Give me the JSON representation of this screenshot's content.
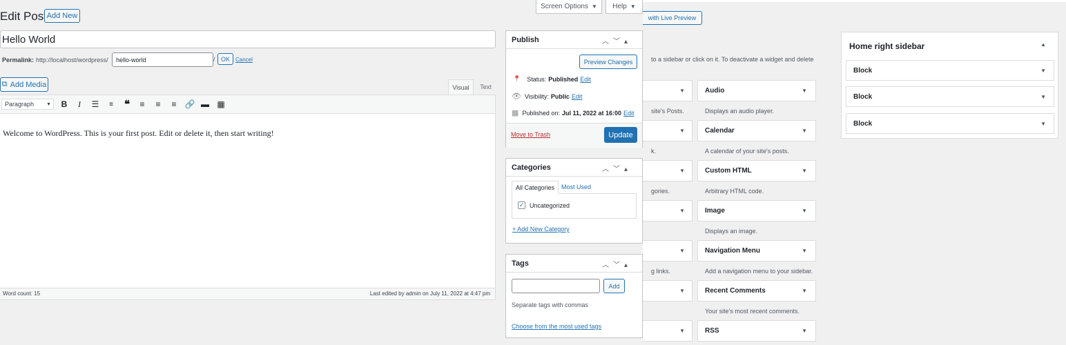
{
  "header": {
    "page_title": "Edit Post",
    "add_new_label": "Add New",
    "screen_options_label": "Screen Options",
    "help_label": "Help"
  },
  "post": {
    "title": "Hello World",
    "permalink_label": "Permalink:",
    "permalink_base": "http://localhost/wordpress/",
    "slug": "hello-world",
    "slug_suffix": "/",
    "ok_label": "OK",
    "cancel_label": "Cancel"
  },
  "editor": {
    "add_media_label": "Add Media",
    "tab_visual": "Visual",
    "tab_text": "Text",
    "format_select": "Paragraph",
    "content": "Welcome to WordPress. This is your first post. Edit or delete it, then start writing!",
    "word_count": "Word count: 15",
    "last_edited": "Last edited by admin on July 11, 2022 at 4:47 pm"
  },
  "publish": {
    "title": "Publish",
    "preview_label": "Preview Changes",
    "status_label": "Status:",
    "status_value": "Published",
    "visibility_label": "Visibility:",
    "visibility_value": "Public",
    "published_label": "Published on:",
    "published_value": "Jul 11, 2022 at 16:00",
    "edit_label": "Edit",
    "trash_label": "Move to Trash",
    "update_label": "Update"
  },
  "categories": {
    "title": "Categories",
    "tab_all": "All Categories",
    "tab_most_used": "Most Used",
    "items": [
      {
        "label": "Uncategorized",
        "checked": true
      }
    ],
    "add_new_label": "+ Add New Category"
  },
  "tags": {
    "title": "Tags",
    "add_label": "Add",
    "hint": "Separate tags with commas",
    "choose_label": "Choose from the most used tags"
  },
  "widgets": {
    "live_preview_label": "with Live Preview",
    "intro_text": "to a sidebar or click on it. To deactivate a widget and delete",
    "left_column_descs": [
      "site's Posts.",
      "k.",
      "gories.",
      "",
      "g links.",
      ""
    ],
    "items": [
      {
        "name": "Audio",
        "desc": "Displays an audio player."
      },
      {
        "name": "Calendar",
        "desc": "A calendar of your site's posts."
      },
      {
        "name": "Custom HTML",
        "desc": "Arbitrary HTML code."
      },
      {
        "name": "Image",
        "desc": "Displays an image."
      },
      {
        "name": "Navigation Menu",
        "desc": "Add a navigation menu to your sidebar."
      },
      {
        "name": "Recent Comments",
        "desc": "Your site's most recent comments."
      },
      {
        "name": "RSS",
        "desc": ""
      }
    ]
  },
  "sidebar": {
    "title": "Home right sidebar",
    "blocks": [
      "Block",
      "Block",
      "Block"
    ]
  },
  "colors": {
    "accent": "#2271b1",
    "background": "#f0f0f1",
    "trash": "#b32d2e"
  }
}
